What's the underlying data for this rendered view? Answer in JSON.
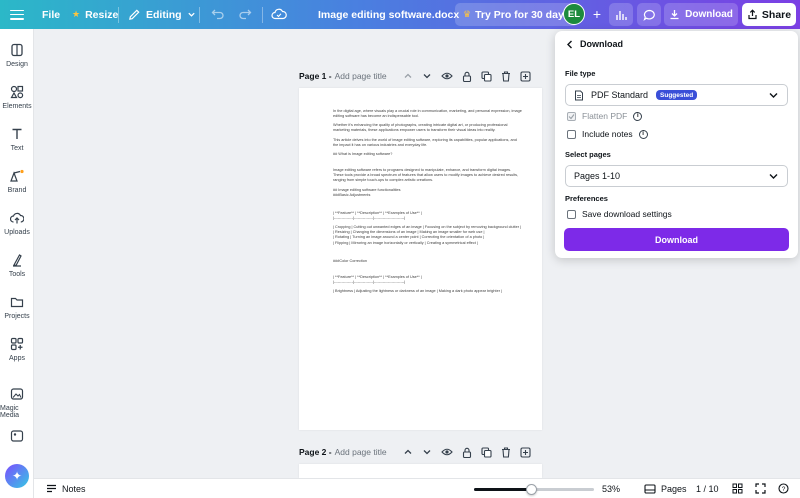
{
  "topbar": {
    "file_label": "File",
    "resize_label": "Resize",
    "editing_label": "Editing",
    "doc_title": "Image editing software.docx",
    "try_pro_label": "Try Pro for 30 days",
    "avatar_initials": "EL",
    "download_label": "Download",
    "share_label": "Share"
  },
  "sidebar": {
    "items": [
      {
        "label": "Design",
        "icon": "design-icon"
      },
      {
        "label": "Elements",
        "icon": "elements-icon"
      },
      {
        "label": "Text",
        "icon": "text-icon"
      },
      {
        "label": "Brand",
        "icon": "brand-icon"
      },
      {
        "label": "Uploads",
        "icon": "uploads-icon"
      },
      {
        "label": "Tools",
        "icon": "tools-icon"
      },
      {
        "label": "Projects",
        "icon": "projects-icon"
      },
      {
        "label": "Apps",
        "icon": "apps-icon"
      },
      {
        "label": "Magic Media",
        "icon": "magic-media-icon"
      }
    ]
  },
  "canvas": {
    "page1": {
      "title": "Page 1 -",
      "add_title": "Add page title"
    },
    "page2": {
      "title": "Page 2 -",
      "add_title": "Add page title"
    },
    "doc_lines": [
      "In the digital age, where visuals play a crucial role in communication, marketing, and personal expression, image editing software has become an indispensable tool.",
      "Whether it's enhancing the quality of photographs, creating intricate digital art, or producing professional marketing materials, these applications empower users to transform their visual ideas into reality.",
      "This article delves into the world of image editing software, exploring its capabilities, popular applications, and the impact it has on various industries and everyday life.",
      "## What is Image editing software?",
      "Image editing software refers to programs designed to manipulate, enhance, and transform digital images. These tools provide a broad spectrum of features that allow users to modify images to achieve desired results, ranging from simple touch-ups to complex artistic creations.",
      "## Image editing software functionalities\n###Basic Adjustments",
      "| **Feature** | **Description** | **Examples of Use** |\n|---------------|---------------|------------------------|",
      "| Cropping | Cutting out unwanted edges of an image | Focusing on the subject by removing background clutter |\n| Resizing | Changing the dimensions of an image | Making an image smaller for web use |\n| Rotating | Turning an image around a center point | Correcting the orientation of a photo |\n| Flipping | Mirroring an image horizontally or vertically | Creating a symmetrical effect |",
      "###Color Correction",
      "| **Feature** | **Description** | **Examples of Use** |\n|---------------|---------------|------------------------|",
      "| Brightness | Adjusting the lightness or darkness of an image | Making a dark photo appear brighter |"
    ]
  },
  "bottombar": {
    "notes_label": "Notes",
    "zoom_label": "53%",
    "zoom_fraction": 0.53,
    "pages_label": "Pages",
    "page_count": "1 / 10"
  },
  "download_panel": {
    "title": "Download",
    "file_type_label": "File type",
    "file_type_value": "PDF Standard",
    "suggested_badge": "Suggested",
    "flatten_pdf_label": "Flatten PDF",
    "include_notes_label": "Include notes",
    "select_pages_label": "Select pages",
    "pages_value": "Pages 1-10",
    "preferences_label": "Preferences",
    "save_settings_label": "Save download settings",
    "download_button_label": "Download",
    "button_color": "#7d2ae8"
  }
}
